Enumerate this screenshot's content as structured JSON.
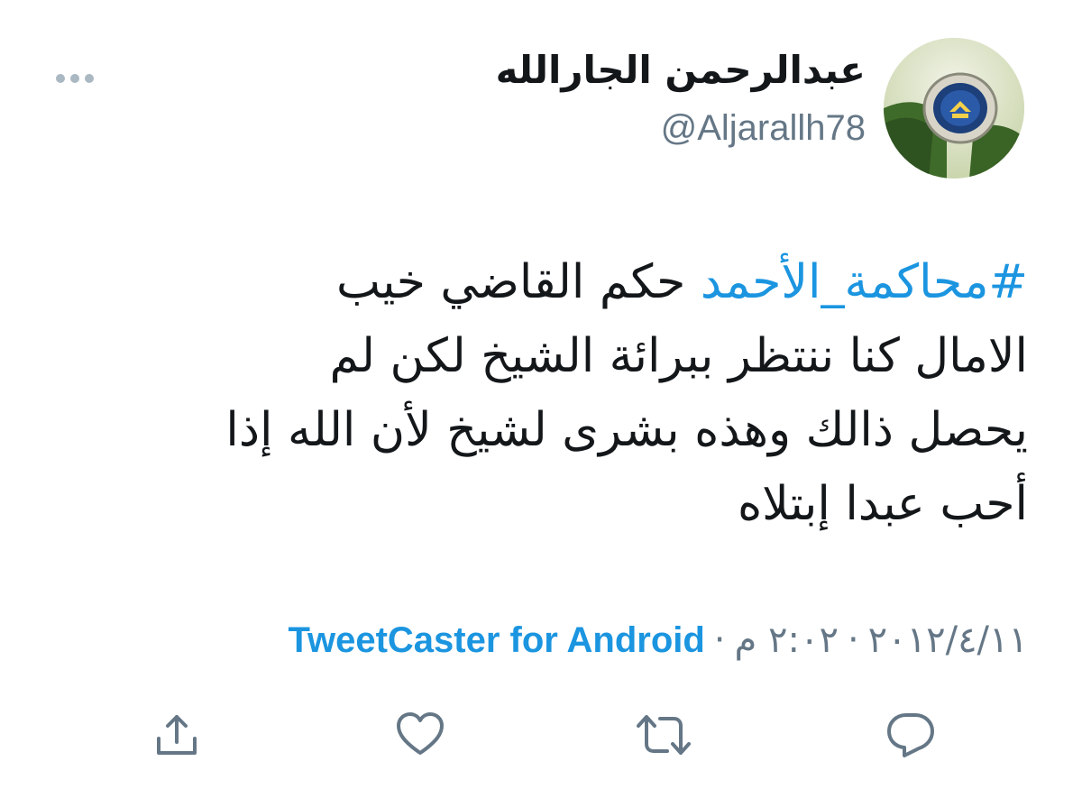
{
  "author": {
    "display_name": "عبدالرحمن الجارالله",
    "handle": "@Aljarallh78",
    "avatar_icon": "badge-emblem-avatar"
  },
  "tweet": {
    "hashtag": "#محاكمة_الأحمد",
    "line1_rest": " حكم القاضي خيب",
    "line2": "الامال كنا ننتظر ببرائة الشيخ لكن لم",
    "line3": "يحصل ذالك وهذه بشرى لشيخ لأن الله إذا",
    "line4": "أحب عبدا إبتلاه"
  },
  "meta": {
    "date": "٢٠١٢/٤/١١",
    "separator": "·",
    "time": "٢:٠٢ م",
    "source": "TweetCaster for Android"
  },
  "actions": [
    {
      "name": "reply-icon"
    },
    {
      "name": "retweet-icon"
    },
    {
      "name": "like-icon"
    },
    {
      "name": "share-icon"
    }
  ],
  "colors": {
    "accent": "#1b95e0",
    "secondary_text": "#657786",
    "primary_text": "#14171a",
    "icon": "#657786"
  }
}
